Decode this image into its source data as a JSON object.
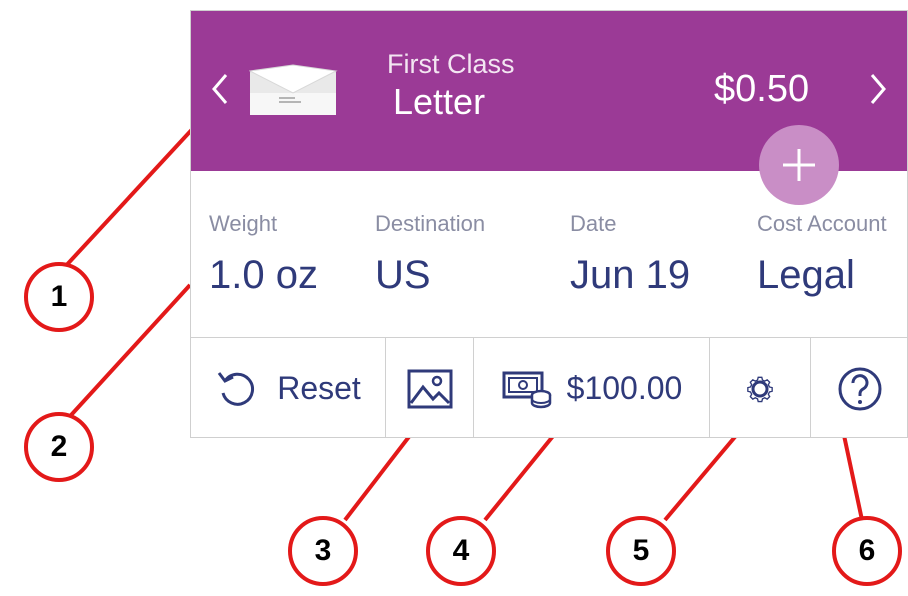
{
  "header": {
    "prev_icon": "chevron-left-icon",
    "next_icon": "chevron-right-icon",
    "mail_class": "First Class",
    "mail_type": "Letter",
    "price": "$0.50",
    "add_icon": "plus-icon",
    "background_color": "#9b3a96"
  },
  "fields": {
    "weight": {
      "label": "Weight",
      "value": "1.0 oz"
    },
    "destination": {
      "label": "Destination",
      "value": "US"
    },
    "date": {
      "label": "Date",
      "value": "Jun 19"
    },
    "cost_account": {
      "label": "Cost Account",
      "value": "Legal"
    }
  },
  "toolbar": {
    "reset_label": "Reset",
    "reset_icon": "reset-arrow-icon",
    "image_icon": "image-icon",
    "funds_icon": "postage-funds-icon",
    "funds_value": "$100.00",
    "settings_icon": "gear-icon",
    "help_icon": "help-icon"
  },
  "callouts": [
    "1",
    "2",
    "3",
    "4",
    "5",
    "6"
  ],
  "callout_color": "#e31919"
}
